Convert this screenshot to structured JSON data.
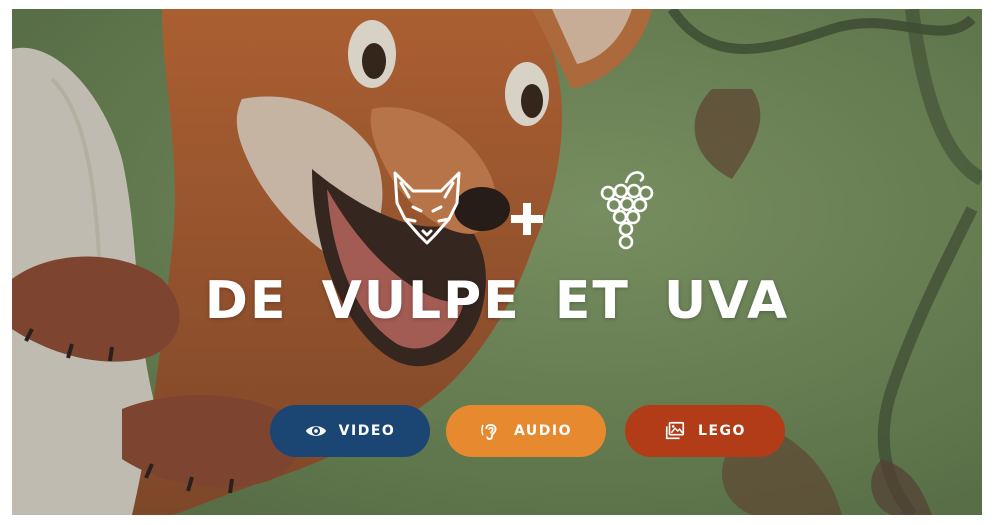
{
  "title": "DE VULPE ET UVA",
  "icons": {
    "left": "fox-head-icon",
    "middle": "plus-icon",
    "right": "grapes-icon"
  },
  "buttons": [
    {
      "label": "VIDEO",
      "icon": "eye-icon",
      "color": "#1b4573"
    },
    {
      "label": "AUDIO",
      "icon": "ear-icon",
      "color": "#e7892f"
    },
    {
      "label": "LEGO",
      "icon": "images-icon",
      "color": "#b13c17"
    }
  ],
  "colors": {
    "background": "#6f8a5c",
    "text": "#ffffff"
  }
}
